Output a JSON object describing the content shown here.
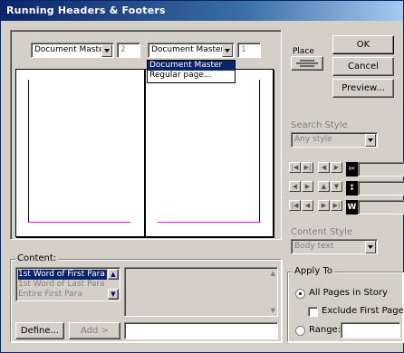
{
  "window": {
    "title": "Running Headers & Footers"
  },
  "header_controls": {
    "left_combo": "Document Master",
    "left_number": "2",
    "right_combo": "Document Master",
    "right_number": "1"
  },
  "dropdown_menu": {
    "items": [
      "Document Master",
      "Regular page..."
    ],
    "selected_index": 0
  },
  "buttons": {
    "ok": "OK",
    "cancel": "Cancel",
    "preview": "Preview...",
    "define": "Define...",
    "add": "Add >"
  },
  "place": {
    "label": "Place"
  },
  "search_style": {
    "label": "Search Style",
    "value": "Any style"
  },
  "content_style": {
    "label": "Content Style",
    "value": "Body text"
  },
  "content": {
    "label": "Content:",
    "items": [
      "1st Word of First Para",
      "1st Word of Last Para",
      "Entire First Para"
    ],
    "selected_index": 0,
    "text_value": ""
  },
  "apply_to": {
    "label": "Apply To",
    "all_pages": "All Pages in Story",
    "exclude_first": "Exclude First Page",
    "range": "Range:",
    "range_value": "",
    "selected": "all_pages",
    "exclude_checked": false
  },
  "tool_icons": [
    "scissors-icon",
    "tall-cursor-icon",
    "w-bracket-icon"
  ],
  "colors": {
    "title_start": "#0a246a",
    "margin_top": "#00008b",
    "margin_bottom": "#ff00ff",
    "selection": "#0a246a"
  }
}
